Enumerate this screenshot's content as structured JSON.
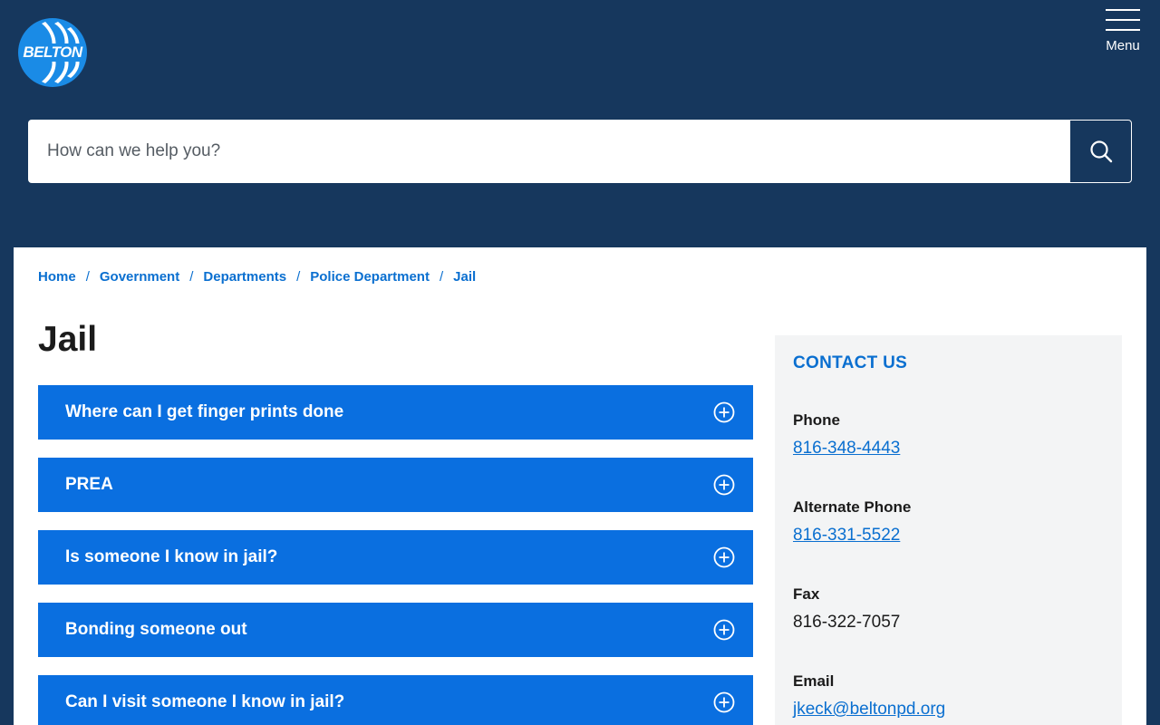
{
  "header": {
    "logo_text": "BELTON",
    "menu_label": "Menu"
  },
  "search": {
    "placeholder": "How can we help you?"
  },
  "breadcrumb": {
    "items": [
      "Home",
      "Government",
      "Departments",
      "Police Department",
      "Jail"
    ],
    "separator": "/"
  },
  "page": {
    "title": "Jail"
  },
  "accordion": {
    "items": [
      "Where can I get finger prints done",
      "PREA",
      "Is someone I know in jail?",
      "Bonding someone out",
      "Can I visit someone I know in jail?"
    ]
  },
  "contact": {
    "title": "CONTACT US",
    "phone_label": "Phone",
    "phone": "816-348-4443",
    "alt_phone_label": "Alternate Phone",
    "alt_phone": "816-331-5522",
    "fax_label": "Fax",
    "fax": "816-322-7057",
    "email_label": "Email",
    "email": "jkeck@beltonpd.org"
  },
  "colors": {
    "header_bg": "#16375d",
    "accent_blue": "#0a6fe0",
    "link_blue": "#0a6fd0",
    "sidebar_bg": "#f3f4f5"
  },
  "icons": {
    "search": "search-icon",
    "accordion_toggle": "plus-circle-icon",
    "menu": "hamburger-icon"
  }
}
